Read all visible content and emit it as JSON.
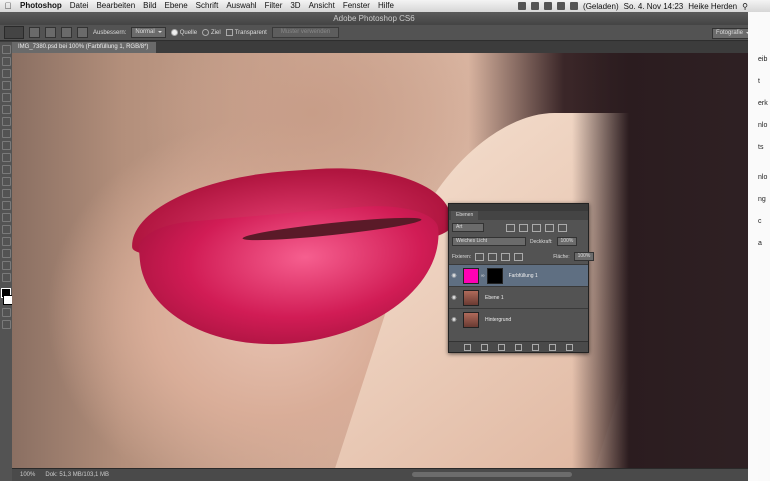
{
  "menubar": {
    "app": "Photoshop",
    "items": [
      "Datei",
      "Bearbeiten",
      "Bild",
      "Ebene",
      "Schrift",
      "Auswahl",
      "Filter",
      "3D",
      "Ansicht",
      "Fenster",
      "Hilfe"
    ],
    "battery": "(Geladen)",
    "clock": "So. 4. Nov 14:23",
    "user": "Heike Herden"
  },
  "window": {
    "title": "Adobe Photoshop CS6"
  },
  "options": {
    "ausbessern_label": "Ausbessern:",
    "mode_value": "Normal",
    "quelle": "Quelle",
    "ziel": "Ziel",
    "transparent": "Transparent",
    "muster_button": "Muster verwenden",
    "workspace": "Fotografie"
  },
  "document": {
    "tab": "IMG_7380.psd bei 100% (Farbfüllung 1, RGB/8*)"
  },
  "status": {
    "zoom": "100%",
    "doc": "Dok: 51,3 MB/103,1 MB"
  },
  "layers_panel": {
    "tab": "Ebenen",
    "filter_kind": "Art",
    "blend_mode": "Weiches Licht",
    "opacity_label": "Deckkraft:",
    "opacity_value": "100%",
    "lock_label": "Fixieren:",
    "fill_label": "Fläche:",
    "fill_value": "100%",
    "layers": [
      {
        "name": "Farbfüllung 1",
        "thumb_color": "#ff00b4",
        "active": true
      },
      {
        "name": "Ebene 1",
        "thumb_color": "#8a4a3e",
        "active": false
      },
      {
        "name": "Hintergrund",
        "thumb_color": "#8a4a3e",
        "active": false
      }
    ],
    "footer_icons": [
      "link-icon",
      "fx-icon",
      "mask-icon",
      "adjustment-icon",
      "group-icon",
      "new-layer-icon",
      "trash-icon"
    ]
  },
  "right_doc": {
    "lines": [
      "eib",
      "t",
      "erk",
      "nlo",
      "ts",
      "nlo",
      "ng",
      "c",
      "a"
    ]
  }
}
